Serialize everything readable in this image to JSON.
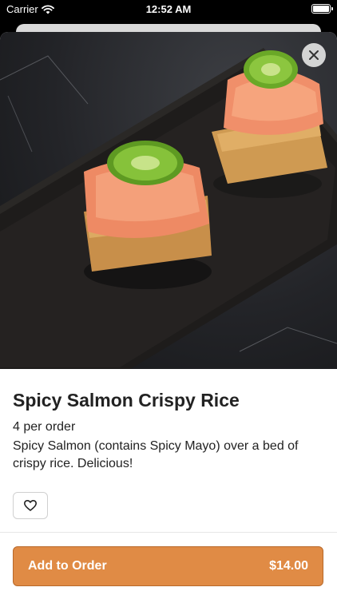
{
  "status_bar": {
    "carrier": "Carrier",
    "time": "12:52 AM"
  },
  "item": {
    "title": "Spicy Salmon Crispy Rice",
    "portion": "4 per order",
    "description": "Spicy Salmon (contains Spicy Mayo) over a bed of crispy rice. Delicious!"
  },
  "order_button": {
    "label": "Add to Order",
    "price": "$14.00"
  },
  "icons": {
    "close": "close-icon",
    "favorite": "heart-icon",
    "wifi": "wifi-icon",
    "battery": "battery-icon"
  },
  "colors": {
    "accent": "#e08b45",
    "accent_border": "#b8692a"
  }
}
